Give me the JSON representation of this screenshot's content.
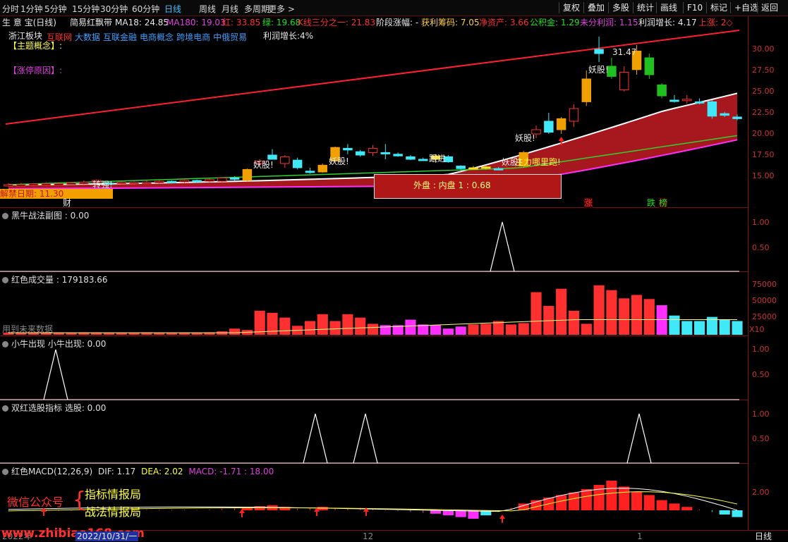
{
  "toolbar": {
    "periods": [
      "分时",
      "1分钟",
      "5分钟",
      "15分钟",
      "30分钟",
      "60分钟",
      "日线",
      "周线",
      "月线",
      "多周期",
      "更多 >"
    ],
    "active_period": "日线",
    "right_buttons": [
      "复权",
      "叠加",
      "多股",
      "统计",
      "画线",
      "F10",
      "标记",
      "+自选",
      "返回"
    ]
  },
  "main": {
    "app_title": "生 意 宝(日线)",
    "indicator_name": "简易红飘带",
    "ma18": "MA18: 24.85",
    "ma180": "MA180: 19.03",
    "red": "红: 33.85",
    "green": "绿: 19.68",
    "k3": "K线三分之一: 21.83",
    "stage": "阶段涨幅: -",
    "profit_chips": "获利筹码: 7.05",
    "net_assets": "净资产: 3.66",
    "reserve": "公积金: 1.29",
    "undistributed": "未分利润: 1.15",
    "profit_growth": "利润增长: 4.17",
    "limit_up": "上涨: 2◇",
    "sector_label": "浙江板块",
    "concepts": [
      "互联网",
      "大数据",
      "互联金融",
      "电商概念",
      "跨境电商",
      "中俄贸易"
    ],
    "profit_growth2": "利润增长:4%",
    "theme_label": "【主题概念】:",
    "reason_label": "【涨停原因】:",
    "unlock_label": "解禁日期: 11.30",
    "cai": "财",
    "outer_inner": "外盘 : 内盘  1 : 0.68",
    "high_label": "31.47",
    "yaogu1": "妖股!",
    "yaogu2": "妖股!",
    "yaogu3": "妖股!",
    "yaogu4": "妖股!",
    "yaogu5": "妖股!",
    "zhuijin": "跟进",
    "runaway": "主力哪里跑!",
    "zhuanji": "转强!",
    "zhang": "涨",
    "die": "跌",
    "bang": "榜",
    "yaxis": [
      "30.00",
      "27.50",
      "25.00",
      "22.50",
      "20.00",
      "17.50",
      "15.00"
    ]
  },
  "panel1": {
    "title": "黑牛战法副图 : 0.00",
    "yaxis": [
      "1.00",
      "0.50"
    ]
  },
  "panel2": {
    "title": "红色成交量 : 179183.66",
    "note": "用到未来数据",
    "yaxis": [
      "75000",
      "50000",
      "25000"
    ],
    "unit": "X10"
  },
  "panel3": {
    "title": "小牛出现  小牛出现: 0.00",
    "yaxis": [
      "1.00",
      "0.50"
    ]
  },
  "panel4": {
    "title": "双红选股指标  选股: 0.00",
    "yaxis": [
      "1.00",
      "0.50"
    ]
  },
  "panel5": {
    "title_name": "红色MACD(12,26,9)",
    "dif": "DIF: 1.17",
    "dea": "DEA: 2.02",
    "macd": "MACD: -1.71 : 18.00",
    "yaxis": [
      "2.00"
    ],
    "wechat": "微信公众号",
    "ad1": "指标情报局",
    "ad2": "战法情报局"
  },
  "bottom": {
    "url": "www.zhibiao168.com",
    "date": "2022/10/31/一",
    "year": "2022年",
    "m12": "12",
    "m1": "1",
    "period": "日线"
  },
  "chart_data": {
    "type": "candlestick",
    "price_range": [
      12.5,
      32.5
    ],
    "candles": [
      {
        "o": 14.0,
        "h": 14.2,
        "l": 13.8,
        "c": 14.0,
        "k": "red"
      },
      {
        "o": 14.0,
        "h": 14.2,
        "l": 13.8,
        "c": 14.0,
        "k": "red"
      },
      {
        "o": 14.0,
        "h": 14.2,
        "l": 13.8,
        "c": 14.1,
        "k": "red"
      },
      {
        "o": 14.0,
        "h": 14.3,
        "l": 13.8,
        "c": 14.1,
        "k": "red"
      },
      {
        "o": 14.1,
        "h": 14.3,
        "l": 13.9,
        "c": 14.1,
        "k": "red"
      },
      {
        "o": 14.1,
        "h": 14.3,
        "l": 13.9,
        "c": 14.2,
        "k": "red"
      },
      {
        "o": 14.1,
        "h": 14.5,
        "l": 13.9,
        "c": 14.3,
        "k": "red"
      },
      {
        "o": 14.3,
        "h": 14.6,
        "l": 14.1,
        "c": 14.5,
        "k": "red"
      },
      {
        "o": 14.2,
        "h": 14.4,
        "l": 14.0,
        "c": 14.2,
        "k": "cyan"
      },
      {
        "o": 14.2,
        "h": 14.4,
        "l": 14.0,
        "c": 14.3,
        "k": "red"
      },
      {
        "o": 14.2,
        "h": 14.4,
        "l": 14.0,
        "c": 14.3,
        "k": "red"
      },
      {
        "o": 14.3,
        "h": 14.5,
        "l": 14.1,
        "c": 14.3,
        "k": "red"
      },
      {
        "o": 14.3,
        "h": 14.5,
        "l": 14.1,
        "c": 14.4,
        "k": "red"
      },
      {
        "o": 14.4,
        "h": 14.5,
        "l": 14.2,
        "c": 14.4,
        "k": "cyan"
      },
      {
        "o": 14.4,
        "h": 14.6,
        "l": 14.2,
        "c": 14.5,
        "k": "red"
      },
      {
        "o": 14.5,
        "h": 14.6,
        "l": 14.2,
        "c": 14.4,
        "k": "cyan"
      },
      {
        "o": 14.4,
        "h": 14.7,
        "l": 14.2,
        "c": 14.6,
        "k": "red"
      },
      {
        "o": 14.4,
        "h": 14.9,
        "l": 14.3,
        "c": 14.8,
        "k": "red"
      },
      {
        "o": 14.8,
        "h": 15.0,
        "l": 14.5,
        "c": 14.7,
        "k": "cyan"
      },
      {
        "o": 14.5,
        "h": 15.9,
        "l": 14.4,
        "c": 15.8,
        "k": "gold"
      },
      {
        "o": 16.5,
        "h": 17.0,
        "l": 16.2,
        "c": 16.8,
        "k": "red"
      },
      {
        "o": 17.5,
        "h": 18.2,
        "l": 17.0,
        "c": 17.0,
        "k": "cyan"
      },
      {
        "o": 16.5,
        "h": 17.5,
        "l": 16.0,
        "c": 17.3,
        "k": "red"
      },
      {
        "o": 16.9,
        "h": 17.2,
        "l": 15.8,
        "c": 16.0,
        "k": "cyan"
      },
      {
        "o": 15.6,
        "h": 16.0,
        "l": 15.3,
        "c": 15.5,
        "k": "cyan"
      },
      {
        "o": 15.5,
        "h": 16.5,
        "l": 15.4,
        "c": 16.3,
        "k": "gold"
      },
      {
        "o": 16.8,
        "h": 18.5,
        "l": 16.5,
        "c": 18.4,
        "k": "gold"
      },
      {
        "o": 18.3,
        "h": 18.8,
        "l": 17.6,
        "c": 18.1,
        "k": "cyan"
      },
      {
        "o": 17.9,
        "h": 18.1,
        "l": 17.3,
        "c": 17.5,
        "k": "cyan"
      },
      {
        "o": 17.8,
        "h": 18.7,
        "l": 17.4,
        "c": 18.3,
        "k": "red"
      },
      {
        "o": 17.8,
        "h": 18.8,
        "l": 17.0,
        "c": 17.8,
        "k": "cyan"
      },
      {
        "o": 17.6,
        "h": 17.8,
        "l": 17.3,
        "c": 17.4,
        "k": "cyan"
      },
      {
        "o": 17.3,
        "h": 17.5,
        "l": 16.9,
        "c": 17.0,
        "k": "cyan"
      },
      {
        "o": 17.0,
        "h": 17.2,
        "l": 16.8,
        "c": 17.0,
        "k": "cyan"
      },
      {
        "o": 17.0,
        "h": 17.6,
        "l": 16.6,
        "c": 17.4,
        "k": "yellow"
      },
      {
        "o": 17.3,
        "h": 17.5,
        "l": 16.6,
        "c": 16.7,
        "k": "cyan"
      },
      {
        "o": 16.2,
        "h": 16.3,
        "l": 15.8,
        "c": 15.9,
        "k": "cyan"
      },
      {
        "o": 16.0,
        "h": 16.2,
        "l": 15.9,
        "c": 16.0,
        "k": "yellow"
      },
      {
        "o": 16.0,
        "h": 16.2,
        "l": 15.8,
        "c": 16.1,
        "k": "yellow"
      },
      {
        "o": 15.9,
        "h": 16.1,
        "l": 15.7,
        "c": 15.8,
        "k": "cyan"
      },
      {
        "o": 16.1,
        "h": 16.5,
        "l": 15.9,
        "c": 16.3,
        "k": "red"
      },
      {
        "o": 16.2,
        "h": 18.0,
        "l": 16.0,
        "c": 17.8,
        "k": "gold"
      },
      {
        "o": 20.0,
        "h": 21.0,
        "l": 19.5,
        "c": 20.5,
        "k": "red"
      },
      {
        "o": 21.5,
        "h": 22.5,
        "l": 20.0,
        "c": 20.2,
        "k": "cyan"
      },
      {
        "o": 20.5,
        "h": 22.0,
        "l": 20.0,
        "c": 21.8,
        "k": "gold"
      },
      {
        "o": 21.5,
        "h": 23.5,
        "l": 20.8,
        "c": 23.0,
        "k": "red"
      },
      {
        "o": 23.8,
        "h": 27.5,
        "l": 23.3,
        "c": 26.5,
        "k": "gold"
      },
      {
        "o": 29.5,
        "h": 31.5,
        "l": 28.5,
        "c": 30.0,
        "k": "cyan"
      },
      {
        "o": 28.0,
        "h": 29.0,
        "l": 26.5,
        "c": 26.8,
        "k": "green"
      },
      {
        "o": 25.2,
        "h": 28.0,
        "l": 25.0,
        "c": 27.3,
        "k": "red"
      },
      {
        "o": 27.6,
        "h": 30.5,
        "l": 27.0,
        "c": 29.8,
        "k": "gold"
      },
      {
        "o": 29.0,
        "h": 29.5,
        "l": 26.5,
        "c": 27.0,
        "k": "green"
      },
      {
        "o": 25.8,
        "h": 26.0,
        "l": 24.2,
        "c": 24.5,
        "k": "green"
      },
      {
        "o": 24.0,
        "h": 24.6,
        "l": 23.7,
        "c": 24.0,
        "k": "cyan"
      },
      {
        "o": 24.0,
        "h": 24.6,
        "l": 23.6,
        "c": 24.1,
        "k": "red"
      },
      {
        "o": 23.8,
        "h": 24.2,
        "l": 23.5,
        "c": 23.8,
        "k": "cyan"
      },
      {
        "o": 23.8,
        "h": 24.0,
        "l": 21.8,
        "c": 22.1,
        "k": "cyan"
      },
      {
        "o": 22.4,
        "h": 22.6,
        "l": 22.0,
        "c": 22.2,
        "k": "cyan"
      },
      {
        "o": 22.0,
        "h": 22.3,
        "l": 21.6,
        "c": 21.8,
        "k": "cyan"
      }
    ],
    "volume": [
      {
        "v": 3000,
        "k": "red"
      },
      {
        "v": 3000,
        "k": "red"
      },
      {
        "v": 3500,
        "k": "red"
      },
      {
        "v": 3200,
        "k": "red"
      },
      {
        "v": 3000,
        "k": "red"
      },
      {
        "v": 3000,
        "k": "red"
      },
      {
        "v": 3500,
        "k": "red"
      },
      {
        "v": 3300,
        "k": "red"
      },
      {
        "v": 3000,
        "k": "red"
      },
      {
        "v": 3000,
        "k": "red"
      },
      {
        "v": 3000,
        "k": "red"
      },
      {
        "v": 3500,
        "k": "red"
      },
      {
        "v": 3000,
        "k": "red"
      },
      {
        "v": 3000,
        "k": "red"
      },
      {
        "v": 3200,
        "k": "red"
      },
      {
        "v": 3000,
        "k": "red"
      },
      {
        "v": 3500,
        "k": "red"
      },
      {
        "v": 5000,
        "k": "red"
      },
      {
        "v": 9000,
        "k": "red"
      },
      {
        "v": 7000,
        "k": "red"
      },
      {
        "v": 35000,
        "k": "red"
      },
      {
        "v": 32000,
        "k": "red"
      },
      {
        "v": 25000,
        "k": "red"
      },
      {
        "v": 13000,
        "k": "red"
      },
      {
        "v": 20000,
        "k": "red"
      },
      {
        "v": 30000,
        "k": "red"
      },
      {
        "v": 20000,
        "k": "red"
      },
      {
        "v": 30000,
        "k": "red"
      },
      {
        "v": 25000,
        "k": "red"
      },
      {
        "v": 16000,
        "k": "red"
      },
      {
        "v": 14000,
        "k": "magenta"
      },
      {
        "v": 14000,
        "k": "magenta"
      },
      {
        "v": 22000,
        "k": "magenta"
      },
      {
        "v": 15000,
        "k": "magenta"
      },
      {
        "v": 14000,
        "k": "magenta"
      },
      {
        "v": 9000,
        "k": "magenta"
      },
      {
        "v": 12000,
        "k": "magenta"
      },
      {
        "v": 15000,
        "k": "red"
      },
      {
        "v": 16000,
        "k": "red"
      },
      {
        "v": 20000,
        "k": "red"
      },
      {
        "v": 15000,
        "k": "red"
      },
      {
        "v": 17000,
        "k": "red"
      },
      {
        "v": 62000,
        "k": "red"
      },
      {
        "v": 42000,
        "k": "red"
      },
      {
        "v": 67000,
        "k": "red"
      },
      {
        "v": 35000,
        "k": "red"
      },
      {
        "v": 16000,
        "k": "red"
      },
      {
        "v": 72000,
        "k": "red"
      },
      {
        "v": 65000,
        "k": "red"
      },
      {
        "v": 53000,
        "k": "red"
      },
      {
        "v": 58000,
        "k": "red"
      },
      {
        "v": 52000,
        "k": "red"
      },
      {
        "v": 43000,
        "k": "magenta"
      },
      {
        "v": 28000,
        "k": "cyan"
      },
      {
        "v": 20000,
        "k": "cyan"
      },
      {
        "v": 20000,
        "k": "cyan"
      },
      {
        "v": 26000,
        "k": "cyan"
      },
      {
        "v": 22000,
        "k": "cyan"
      },
      {
        "v": 20000,
        "k": "cyan"
      }
    ],
    "volume_range": [
      0,
      80000
    ],
    "macd": [
      0,
      0,
      0,
      0,
      0,
      0,
      0,
      0,
      0.05,
      0.05,
      0.05,
      0.08,
      0.05,
      0.05,
      0.08,
      0.06,
      0.1,
      0.2,
      0.3,
      0.4,
      0.5,
      0.6,
      0.4,
      0.2,
      0.3,
      0.4,
      0.3,
      0.2,
      0.3,
      0.15,
      0,
      -0.1,
      -0.2,
      -0.3,
      -0.4,
      -0.6,
      -0.8,
      -1.0,
      -0.6,
      -0.2,
      0.3,
      0.8,
      1.2,
      1.5,
      1.8,
      2.1,
      2.5,
      3.0,
      3.5,
      2.8,
      2.2,
      1.8,
      1.2,
      0.8,
      0.4,
      0.1,
      -0.2,
      -0.5,
      -0.8
    ],
    "macd_range": [
      -2,
      4.5
    ]
  }
}
